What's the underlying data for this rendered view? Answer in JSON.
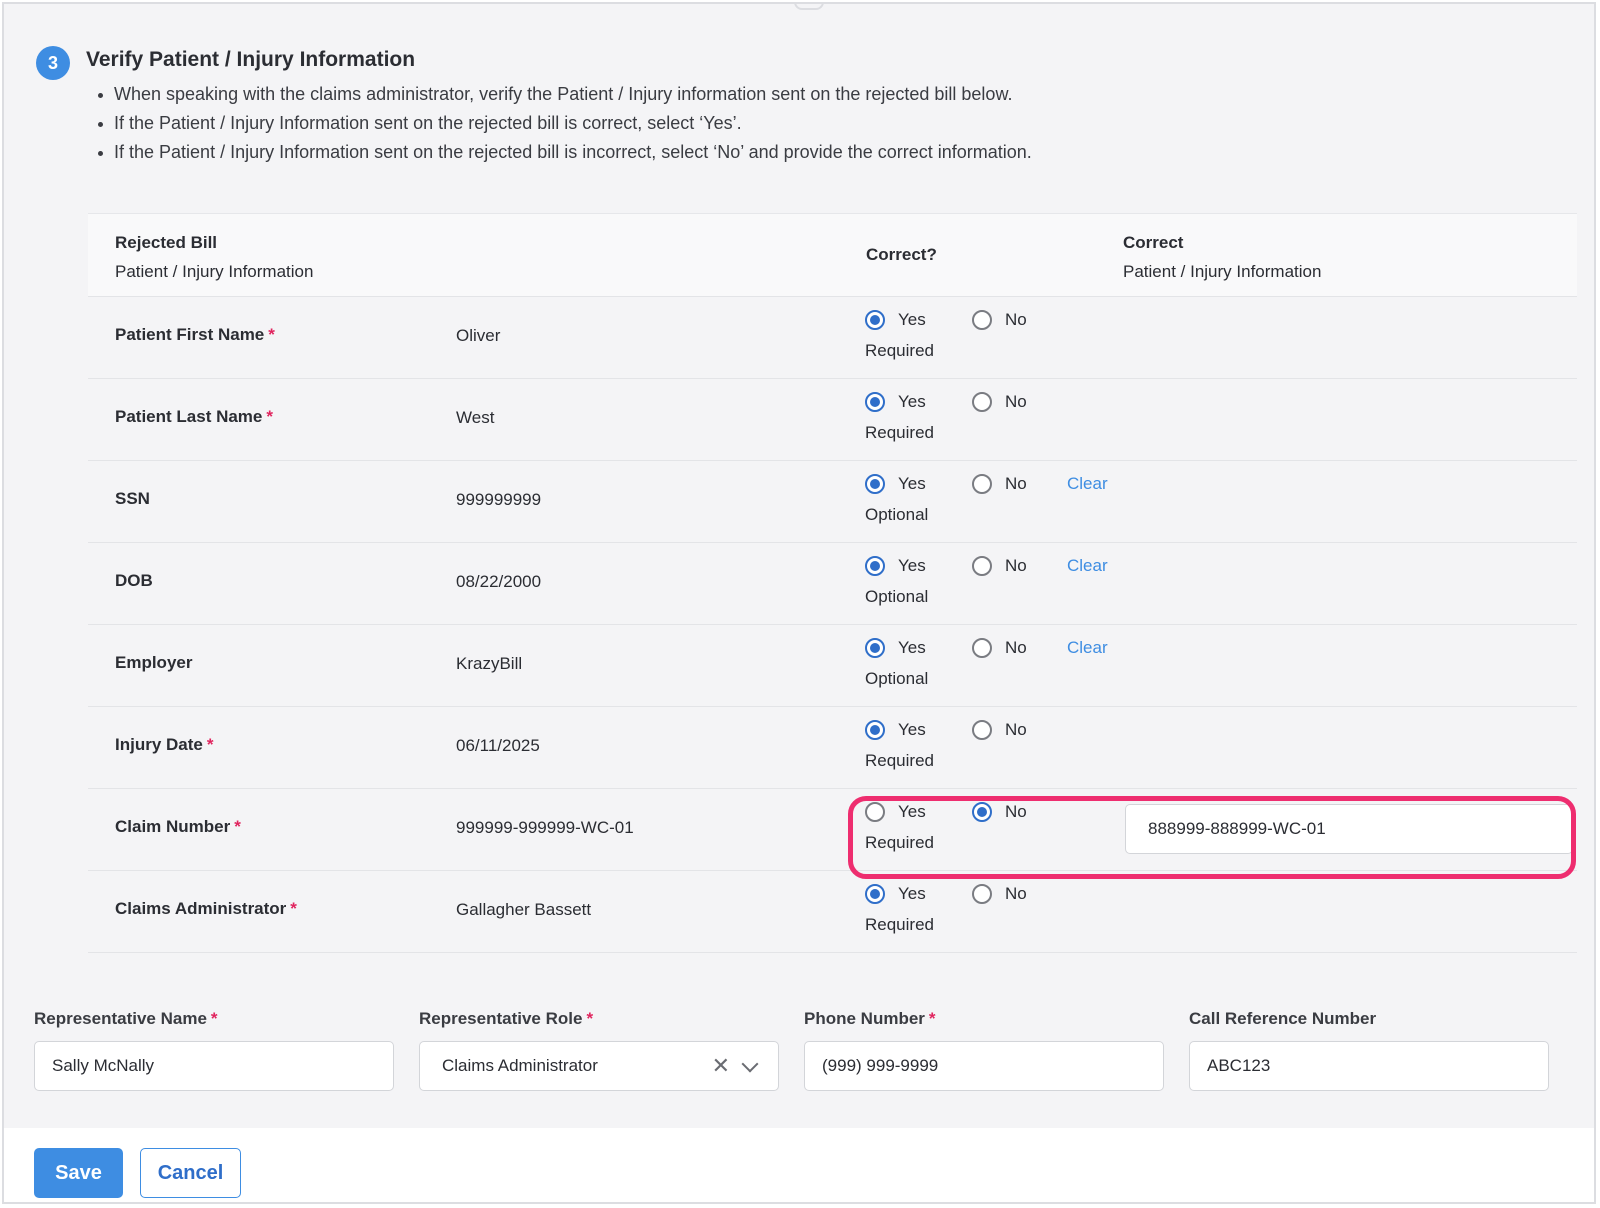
{
  "section": {
    "step_number": "3",
    "title": "Verify Patient / Injury Information",
    "instructions": [
      "When speaking with the claims administrator, verify the Patient / Injury information sent on the rejected bill below.",
      "If the Patient / Injury Information sent on the rejected bill is correct, select ‘Yes’.",
      "If the Patient / Injury Information sent on the rejected bill is incorrect, select ‘No’ and provide the correct information."
    ]
  },
  "table": {
    "header": {
      "rejected_line1": "Rejected Bill",
      "rejected_line2": "Patient / Injury Information",
      "correct": "Correct?",
      "corrected_line1": "Correct",
      "corrected_line2": "Patient / Injury Information"
    },
    "yes_label": "Yes",
    "no_label": "No",
    "clear_label": "Clear",
    "rows": [
      {
        "label": "Patient First Name",
        "required_mark": "*",
        "value": "Oliver",
        "selection": "yes",
        "requirement": "Required",
        "clear": "",
        "corrected_value": ""
      },
      {
        "label": "Patient Last Name",
        "required_mark": "*",
        "value": "West",
        "selection": "yes",
        "requirement": "Required",
        "clear": "",
        "corrected_value": ""
      },
      {
        "label": "SSN",
        "required_mark": "",
        "value": "999999999",
        "selection": "yes",
        "requirement": "Optional",
        "clear": "Clear",
        "corrected_value": ""
      },
      {
        "label": "DOB",
        "required_mark": "",
        "value": "08/22/2000",
        "selection": "yes",
        "requirement": "Optional",
        "clear": "Clear",
        "corrected_value": ""
      },
      {
        "label": "Employer",
        "required_mark": "",
        "value": "KrazyBill",
        "selection": "yes",
        "requirement": "Optional",
        "clear": "Clear",
        "corrected_value": ""
      },
      {
        "label": "Injury Date",
        "required_mark": "*",
        "value": "06/11/2025",
        "selection": "yes",
        "requirement": "Required",
        "clear": "",
        "corrected_value": ""
      },
      {
        "label": "Claim Number",
        "required_mark": "*",
        "value": "999999-999999-WC-01",
        "selection": "no",
        "requirement": "Required",
        "clear": "",
        "corrected_value": "888999-888999-WC-01"
      },
      {
        "label": "Claims Administrator",
        "required_mark": "*",
        "value": "Gallagher Bassett",
        "selection": "yes",
        "requirement": "Required",
        "clear": "",
        "corrected_value": ""
      }
    ]
  },
  "representative": {
    "name": {
      "label": "Representative Name",
      "required_mark": "*",
      "value": "Sally McNally"
    },
    "role": {
      "label": "Representative Role",
      "required_mark": "*",
      "value": "Claims Administrator"
    },
    "phone": {
      "label": "Phone Number",
      "required_mark": "*",
      "value": "(999) 999-9999"
    },
    "call_ref": {
      "label": "Call Reference Number",
      "required_mark": "",
      "value": "ABC123"
    }
  },
  "actions": {
    "save_label": "Save",
    "cancel_label": "Cancel"
  },
  "colors": {
    "accent": "#3e8de2",
    "radio_checked": "#2f6ec9",
    "required": "#e0245e",
    "highlight": "#ee2d6f"
  },
  "icons": {
    "clear_select": "close-icon",
    "select_open": "chevron-down-icon"
  }
}
